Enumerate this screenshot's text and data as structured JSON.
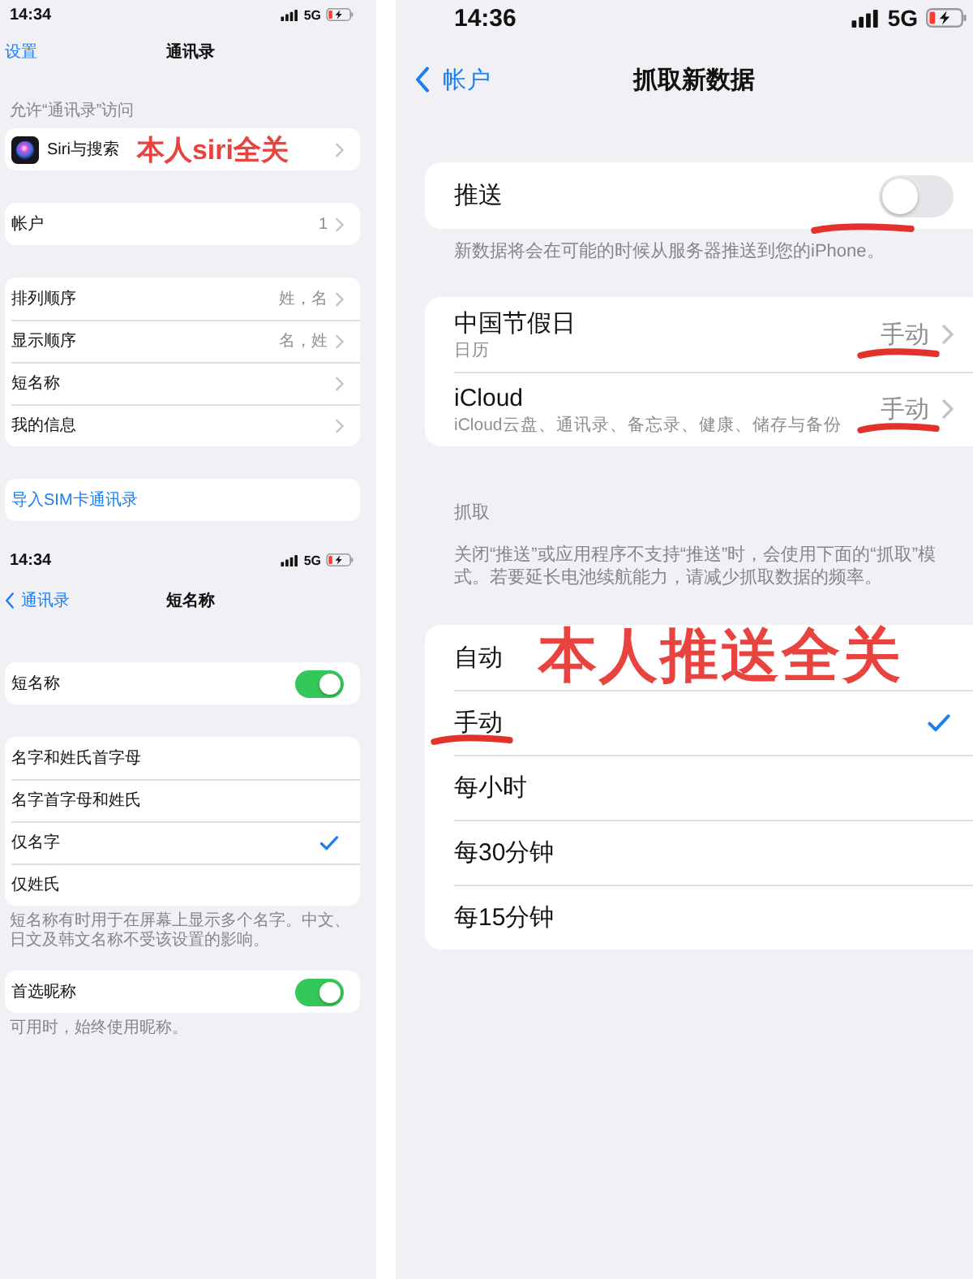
{
  "left_column": [
    {
      "status_bar": {
        "time": "14:34",
        "network": "5G"
      },
      "nav": {
        "back": "设置",
        "back_arrow": false,
        "title": "通讯录"
      },
      "sections": [
        {
          "header": "允许“通讯录”访问",
          "rows": [
            {
              "kind": "app",
              "label": "Siri与搜索",
              "annotation": "本人siri全关"
            }
          ]
        },
        {
          "rows": [
            {
              "kind": "nav",
              "label": "帐户",
              "value": "1"
            }
          ]
        },
        {
          "rows": [
            {
              "kind": "nav",
              "label": "排列顺序",
              "value": "姓，名"
            },
            {
              "kind": "nav",
              "label": "显示顺序",
              "value": "名，姓"
            },
            {
              "kind": "nav",
              "label": "短名称"
            },
            {
              "kind": "nav",
              "label": "我的信息"
            }
          ]
        },
        {
          "rows": [
            {
              "kind": "link",
              "label": "导入SIM卡通讯录"
            }
          ]
        }
      ]
    },
    {
      "status_bar": {
        "time": "14:34",
        "network": "5G"
      },
      "nav": {
        "back": "通讯录",
        "back_arrow": true,
        "title": "短名称"
      },
      "sections": [
        {
          "rows": [
            {
              "kind": "toggle",
              "label": "短名称",
              "on": true
            }
          ]
        },
        {
          "rows": [
            {
              "kind": "check",
              "label": "名字和姓氏首字母",
              "selected": false
            },
            {
              "kind": "check",
              "label": "名字首字母和姓氏",
              "selected": false
            },
            {
              "kind": "check",
              "label": "仅名字",
              "selected": true
            },
            {
              "kind": "check",
              "label": "仅姓氏",
              "selected": false
            }
          ],
          "footer": "短名称有时用于在屏幕上显示多个名字。中文、日文及韩文名称不受该设置的影响。"
        },
        {
          "rows": [
            {
              "kind": "toggle",
              "label": "首选昵称",
              "on": true
            }
          ],
          "footer": "可用时，始终使用昵称。"
        }
      ]
    }
  ],
  "right_column": {
    "status_bar": {
      "time": "14:36",
      "network": "5G"
    },
    "nav": {
      "back": "帐户",
      "back_arrow": true,
      "title": "抓取新数据"
    },
    "sections": [
      {
        "rows": [
          {
            "kind": "toggle",
            "label": "推送",
            "on": false,
            "underlined": true
          }
        ],
        "footer": "新数据将会在可能的时候从服务器推送到您的iPhone。"
      },
      {
        "rows": [
          {
            "kind": "nav",
            "label": "中国节假日",
            "subtitle": "日历",
            "value": "手动",
            "underlined": true
          },
          {
            "kind": "nav",
            "label": "iCloud",
            "subtitle": "iCloud云盘、通讯录、备忘录、健康、储存与备份",
            "value": "手动",
            "underlined": true
          }
        ]
      },
      {
        "header": "抓取",
        "description": "关闭“推送”或应用程序不支持“推送”时，会使用下面的“抓取”模式。若要延长电池续航能力，请减少抓取数据的频率。",
        "rows": [
          {
            "kind": "check",
            "label": "自动",
            "selected": false,
            "underlined": false,
            "annotation": "本人推送全关"
          },
          {
            "kind": "check",
            "label": "手动",
            "selected": true,
            "underlined": true
          },
          {
            "kind": "check",
            "label": "每小时",
            "selected": false,
            "underlined": false
          },
          {
            "kind": "check",
            "label": "每30分钟",
            "selected": false,
            "underlined": false
          },
          {
            "kind": "check",
            "label": "每15分钟",
            "selected": false,
            "underlined": false
          }
        ]
      }
    ]
  }
}
